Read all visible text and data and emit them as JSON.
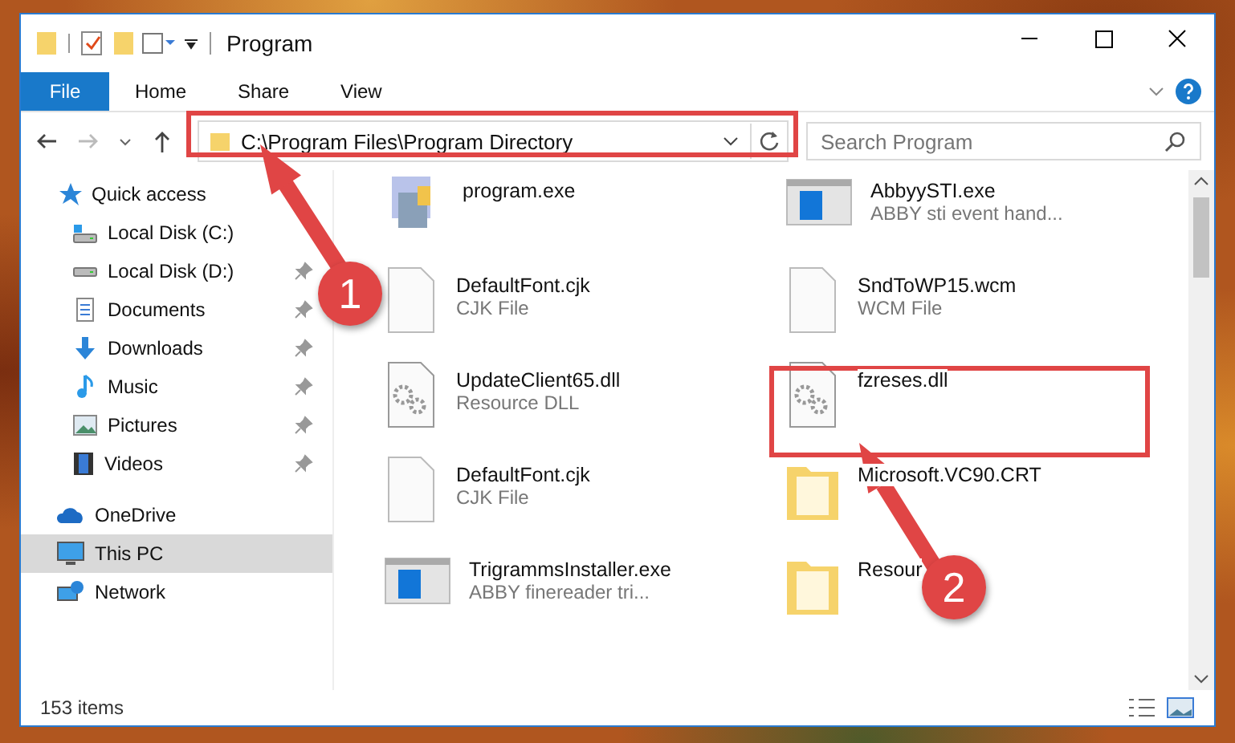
{
  "window": {
    "title": "Program"
  },
  "ribbon_tabs": [
    {
      "label": "File",
      "selected": true
    },
    {
      "label": "Home",
      "selected": false
    },
    {
      "label": "Share",
      "selected": false
    },
    {
      "label": "View",
      "selected": false
    }
  ],
  "address": {
    "path": "C:\\Program Files\\Program Directory"
  },
  "search": {
    "placeholder": "Search Program"
  },
  "navigation": [
    {
      "label": "Quick access",
      "kind": "star",
      "selected": false,
      "children": [
        {
          "label": "Local Disk (C:)",
          "kind": "disk-c",
          "pinned": false
        },
        {
          "label": "Local Disk (D:)",
          "kind": "disk",
          "pinned": true
        },
        {
          "label": "Documents",
          "kind": "documents",
          "pinned": true
        },
        {
          "label": "Downloads",
          "kind": "downloads",
          "pinned": true
        },
        {
          "label": "Music",
          "kind": "music",
          "pinned": true
        },
        {
          "label": "Pictures",
          "kind": "pictures",
          "pinned": true
        },
        {
          "label": "Videos",
          "kind": "videos",
          "pinned": true
        }
      ]
    },
    {
      "label": "OneDrive",
      "kind": "cloud",
      "selected": false
    },
    {
      "label": "This PC",
      "kind": "pc",
      "selected": true
    },
    {
      "label": "Network",
      "kind": "network",
      "selected": false
    }
  ],
  "files": [
    {
      "name": "program.exe",
      "kind": "app"
    },
    {
      "name": "AbbyySTI.exe",
      "type": "ABBY sti event hand...",
      "kind": "window"
    },
    {
      "name": "DefaultFont.cjk",
      "type": "CJK File",
      "kind": "blank"
    },
    {
      "name": "SndToWP15.wcm",
      "type": "WCM File",
      "kind": "blank"
    },
    {
      "name": "UpdateClient65.dll",
      "type": "Resource DLL",
      "kind": "gear"
    },
    {
      "name": "fzreses.dll",
      "kind": "gear"
    },
    {
      "name": "DefaultFont.cjk",
      "type": "CJK File",
      "kind": "blank"
    },
    {
      "name": "Microsoft.VC90.CRT",
      "kind": "folder"
    },
    {
      "name": "TrigrammsInstaller.exe",
      "type": "ABBY finereader tri...",
      "kind": "window"
    },
    {
      "name": "Resour",
      "kind": "folder"
    }
  ],
  "status_bar": {
    "count": "153 items"
  },
  "annotations": [
    {
      "number": "1"
    },
    {
      "number": "2"
    }
  ]
}
